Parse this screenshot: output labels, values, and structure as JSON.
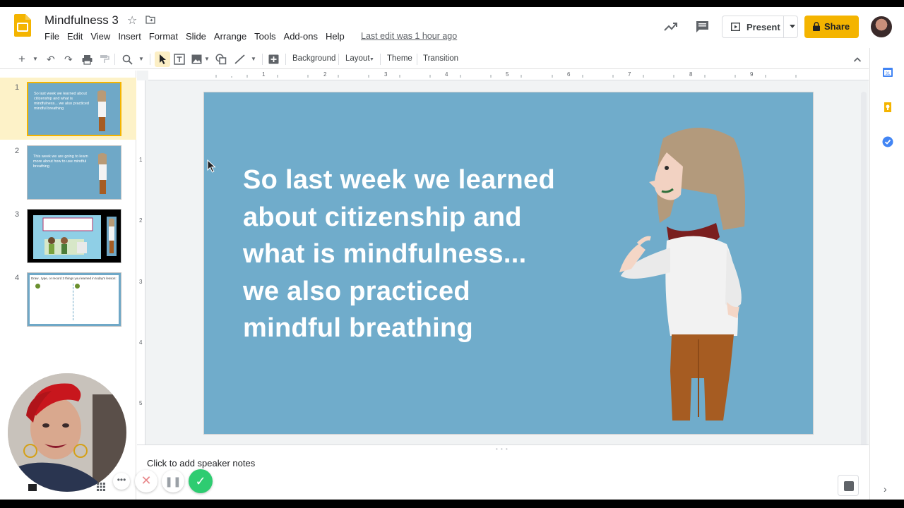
{
  "header": {
    "title": "Mindfulness 3",
    "menus": [
      "File",
      "Edit",
      "View",
      "Insert",
      "Format",
      "Slide",
      "Arrange",
      "Tools",
      "Add-ons",
      "Help"
    ],
    "last_edit": "Last edit was 1 hour ago",
    "present_label": "Present",
    "share_label": "Share"
  },
  "toolbar": {
    "background_label": "Background",
    "layout_label": "Layout",
    "theme_label": "Theme",
    "transition_label": "Transition"
  },
  "filmstrip": {
    "slides": [
      {
        "number": "1",
        "text": "So last week we learned about citizenship and what is mindfulness... we also practiced mindful breathing"
      },
      {
        "number": "2",
        "text": "This week  we are going to learn more about how to use mindful breathing"
      },
      {
        "number": "3",
        "text": ""
      },
      {
        "number": "4",
        "text": "Draw , type, or record  3 things you learned in today's lesson:"
      }
    ]
  },
  "ruler": {
    "top": [
      "1",
      "2",
      "3",
      "4",
      "5",
      "6",
      "7",
      "8",
      "9"
    ],
    "left": [
      "1",
      "2",
      "3",
      "4",
      "5"
    ]
  },
  "slide": {
    "lines": [
      "So last week we learned",
      "about citizenship and",
      "what is mindfulness...",
      "we also practiced",
      "mindful breathing"
    ],
    "background_color": "#70accb"
  },
  "notes": {
    "placeholder": "Click to add speaker notes"
  },
  "colors": {
    "share": "#f4b400",
    "record_done": "#2ecc71"
  }
}
